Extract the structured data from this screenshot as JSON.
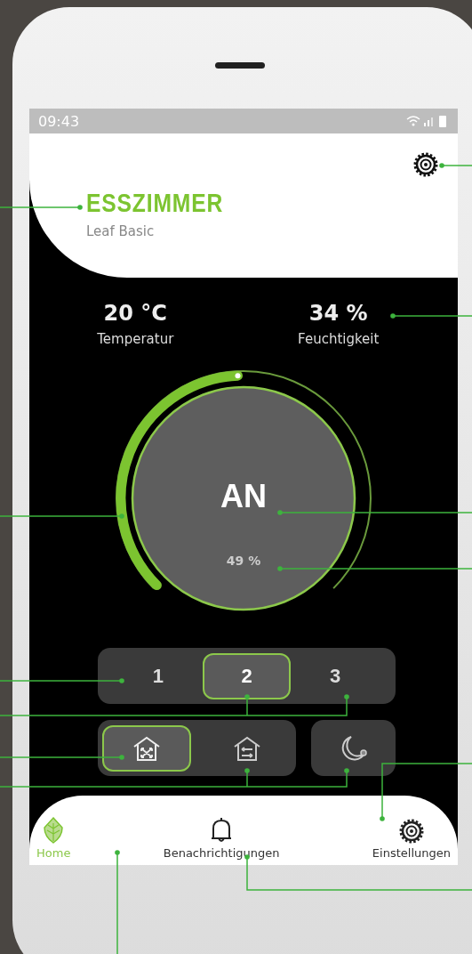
{
  "status_bar": {
    "time": "09:43"
  },
  "header": {
    "title": "ESSZIMMER",
    "subtitle": "Leaf Basic"
  },
  "readings": [
    {
      "value": "20 °C",
      "label": "Temperatur"
    },
    {
      "value": "34 %",
      "label": "Feuchtigkeit"
    }
  ],
  "dial": {
    "on": true,
    "state": "AN",
    "level": 0.49,
    "reading": "49 %"
  },
  "speed_buttons": [
    {
      "label": "1",
      "selected": false
    },
    {
      "label": "2",
      "selected": true
    },
    {
      "label": "3",
      "selected": false
    }
  ],
  "mode_buttons": [
    {
      "kind": "ventilation",
      "selected": true
    },
    {
      "kind": "exhaust",
      "selected": false
    }
  ],
  "night_mode": {
    "selected": false
  },
  "nav": [
    {
      "label": "Home",
      "kind": "home",
      "selected": true
    },
    {
      "label": "Benachrichtigungen",
      "kind": "notifications",
      "selected": false
    },
    {
      "label": "Einstellungen",
      "kind": "settings",
      "selected": false
    }
  ]
}
